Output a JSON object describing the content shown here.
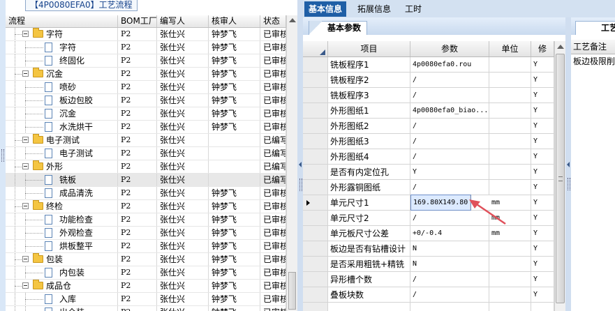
{
  "left_panel": {
    "title": "【4P0080EFA0】工艺流程",
    "columns": [
      "流程",
      "BOM工厂",
      "编写人",
      "核审人",
      "状态"
    ],
    "rows": [
      {
        "name": "字符",
        "level": 1,
        "type": "folder",
        "bom": "P2",
        "author": "张仕兴",
        "reviewer": "钟梦飞",
        "status": "已审核"
      },
      {
        "name": "字符",
        "level": 2,
        "type": "doc",
        "bom": "P2",
        "author": "张仕兴",
        "reviewer": "钟梦飞",
        "status": "已审核"
      },
      {
        "name": "终固化",
        "level": 2,
        "type": "doc",
        "bom": "P2",
        "author": "张仕兴",
        "reviewer": "钟梦飞",
        "status": "已审核"
      },
      {
        "name": "沉金",
        "level": 1,
        "type": "folder",
        "bom": "P2",
        "author": "张仕兴",
        "reviewer": "钟梦飞",
        "status": "已审核"
      },
      {
        "name": "喷砂",
        "level": 2,
        "type": "doc",
        "bom": "P2",
        "author": "张仕兴",
        "reviewer": "钟梦飞",
        "status": "已审核"
      },
      {
        "name": "板边包胶",
        "level": 2,
        "type": "doc",
        "bom": "P2",
        "author": "张仕兴",
        "reviewer": "钟梦飞",
        "status": "已审核"
      },
      {
        "name": "沉金",
        "level": 2,
        "type": "doc",
        "bom": "P2",
        "author": "张仕兴",
        "reviewer": "钟梦飞",
        "status": "已审核"
      },
      {
        "name": "水洗烘干",
        "level": 2,
        "type": "doc",
        "bom": "P2",
        "author": "张仕兴",
        "reviewer": "钟梦飞",
        "status": "已审核"
      },
      {
        "name": "电子测试",
        "level": 1,
        "type": "folder",
        "bom": "P2",
        "author": "张仕兴",
        "reviewer": "",
        "status": "已编写"
      },
      {
        "name": "电子测试",
        "level": 2,
        "type": "doc",
        "bom": "P2",
        "author": "张仕兴",
        "reviewer": "",
        "status": "已编写"
      },
      {
        "name": "外形",
        "level": 1,
        "type": "folder",
        "bom": "P2",
        "author": "张仕兴",
        "reviewer": "",
        "status": "已编写"
      },
      {
        "name": "铣板",
        "level": 2,
        "type": "doc",
        "bom": "P2",
        "author": "张仕兴",
        "reviewer": "",
        "status": "已编写",
        "selected": true
      },
      {
        "name": "成品清洗",
        "level": 2,
        "type": "doc",
        "bom": "P2",
        "author": "张仕兴",
        "reviewer": "钟梦飞",
        "status": "已审核"
      },
      {
        "name": "终检",
        "level": 1,
        "type": "folder",
        "bom": "P2",
        "author": "张仕兴",
        "reviewer": "钟梦飞",
        "status": "已审核"
      },
      {
        "name": "功能检查",
        "level": 2,
        "type": "doc",
        "bom": "P2",
        "author": "张仕兴",
        "reviewer": "钟梦飞",
        "status": "已审核"
      },
      {
        "name": "外观检查",
        "level": 2,
        "type": "doc",
        "bom": "P2",
        "author": "张仕兴",
        "reviewer": "钟梦飞",
        "status": "已审核"
      },
      {
        "name": "烘板整平",
        "level": 2,
        "type": "doc",
        "bom": "P2",
        "author": "张仕兴",
        "reviewer": "钟梦飞",
        "status": "已审核"
      },
      {
        "name": "包装",
        "level": 1,
        "type": "folder",
        "bom": "P2",
        "author": "张仕兴",
        "reviewer": "钟梦飞",
        "status": "已审核"
      },
      {
        "name": "内包装",
        "level": 2,
        "type": "doc",
        "bom": "P2",
        "author": "张仕兴",
        "reviewer": "钟梦飞",
        "status": "已审核"
      },
      {
        "name": "成品仓",
        "level": 1,
        "type": "folder",
        "bom": "P2",
        "author": "张仕兴",
        "reviewer": "钟梦飞",
        "status": "已审核"
      },
      {
        "name": "入库",
        "level": 2,
        "type": "doc",
        "bom": "P2",
        "author": "张仕兴",
        "reviewer": "钟梦飞",
        "status": "已审核"
      },
      {
        "name": "出仓装",
        "level": 2,
        "type": "doc",
        "bom": "P2",
        "author": "张仕兴",
        "reviewer": "钟梦飞",
        "status": "已审核"
      }
    ]
  },
  "tabs": [
    "基本信息",
    "拓展信息",
    "工时"
  ],
  "middle_panel": {
    "subtab": "基本参数",
    "columns": [
      "项目",
      "参数",
      "单位",
      "修"
    ],
    "rows": [
      {
        "item": "铣板程序1",
        "param": "4p0080efa0.rou",
        "unit": "",
        "mod": "Y"
      },
      {
        "item": "铣板程序2",
        "param": "/",
        "unit": "",
        "mod": "Y"
      },
      {
        "item": "铣板程序3",
        "param": "/",
        "unit": "",
        "mod": "Y"
      },
      {
        "item": "外形图纸1",
        "param": "4p0080efa0_biao...",
        "unit": "",
        "mod": "Y"
      },
      {
        "item": "外形图纸2",
        "param": "/",
        "unit": "",
        "mod": "Y"
      },
      {
        "item": "外形图纸3",
        "param": "/",
        "unit": "",
        "mod": "Y"
      },
      {
        "item": "外形图纸4",
        "param": "/",
        "unit": "",
        "mod": "Y"
      },
      {
        "item": "是否有内定位孔",
        "param": "Y",
        "unit": "",
        "mod": "Y"
      },
      {
        "item": "外形露铜图纸",
        "param": "/",
        "unit": "",
        "mod": "Y"
      },
      {
        "item": "单元尺寸1",
        "param": "169.80X149.80",
        "unit": "mm",
        "mod": "Y",
        "current": true,
        "editing": true
      },
      {
        "item": "单元尺寸2",
        "param": "/",
        "unit": "mm",
        "mod": "Y"
      },
      {
        "item": "单元板尺寸公差",
        "param": "+0/-0.4",
        "unit": "mm",
        "mod": "Y"
      },
      {
        "item": "板边是否有钻槽设计",
        "param": "N",
        "unit": "",
        "mod": "Y"
      },
      {
        "item": "是否采用粗铣+精铣",
        "param": "N",
        "unit": "",
        "mod": "Y"
      },
      {
        "item": "异形槽个数",
        "param": "/",
        "unit": "",
        "mod": "Y"
      },
      {
        "item": "叠板块数",
        "param": "/",
        "unit": "",
        "mod": "Y"
      },
      {
        "item": "",
        "param": "",
        "unit": "",
        "mod": ""
      }
    ]
  },
  "right_panel": {
    "tab": "工艺",
    "column": "工艺备注",
    "cell": "板边极限削"
  },
  "colors": {
    "accent": "#1f5fa6",
    "panel_bg": "#d9e7f7",
    "folder": "#f4c542",
    "arrow": "#e0505a"
  },
  "icons": [
    "folder-icon",
    "document-icon",
    "expand-collapse-icon",
    "row-pointer-icon",
    "red-arrow-annotation"
  ]
}
